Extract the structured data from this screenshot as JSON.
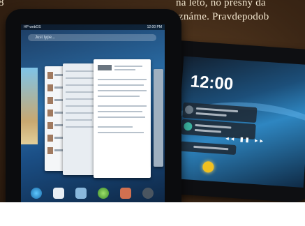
{
  "article": {
    "line1": "na leto, no presny da",
    "line2": "známe. Pravdepodob",
    "corner_char": "8"
  },
  "right_tablet": {
    "clock": "12:00",
    "media_controls": "◂◂ ▮▮ ▸▸"
  },
  "left_tablet": {
    "status_left": "HP webOS",
    "status_right": "12:00 PM",
    "search_placeholder": "Just type...",
    "dock_icons": [
      "browser-icon",
      "email-icon",
      "photos-icon",
      "messaging-icon",
      "calendar-icon",
      "launcher-icon"
    ]
  },
  "colors": {
    "background": "#3b2615",
    "screen_blue": "#2a6ea8",
    "text_cream": "#f3e7d0"
  }
}
